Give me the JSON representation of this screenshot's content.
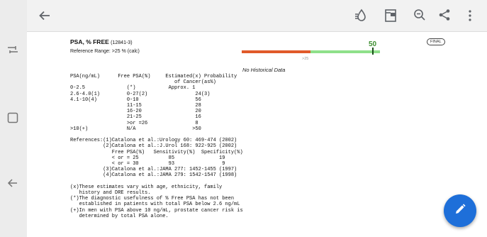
{
  "toolbar": {
    "icons": [
      "back-arrow-icon",
      "accessibility-icon",
      "document-icon",
      "zoom-out-icon",
      "share-icon",
      "more-vert-icon"
    ]
  },
  "system_nav": {
    "icons": [
      "recents-icon",
      "home-icon",
      "back-icon"
    ]
  },
  "test": {
    "title": "PSA, % FREE",
    "code": "(12841-3)",
    "reference_range": "Reference Range: >25 % (calc)",
    "status_badge": "FINAL",
    "value": "50",
    "value_fraction_on_bar": 0.94,
    "bar_threshold_label": ">25",
    "bar_colors": {
      "out_of_range": "#e05a2a",
      "in_range": "#8fe08a",
      "value_text": "#3f8f32"
    }
  },
  "report": {
    "history_note": "No Historical Data",
    "lines": [
      "PSA(ng/mL)      Free PSA(%)     Estimated(x) Probability",
      "                                   of Cancer(as%)",
      "0-2.5              (*)           Approx. 1",
      "2.6-4.0(1)         0-27(2)                24(3)",
      "4.1-10(4)          0-10                   56",
      "                   11-15                  28",
      "                   16-20                  20",
      "                   21-25                  16",
      "                   >or =26                8",
      ">10(+)             N/A                   >50",
      "",
      "References:(1)Catalona et al.:Urology 60: 469-474 (2002)",
      "           (2)Catalona et al.:J.Urol 168: 922-925 (2002)",
      "              Free PSA(%)   Sensitivity(%)  Specificity(%)",
      "              < or = 25          85               19",
      "              < or = 30          93                9",
      "           (3)Catalona et al.:JAMA 277: 1452-1455 (1997)",
      "           (4)Catalona et al.:JAMA 279: 1542-1547 (1998)",
      "",
      "(x)These estimates vary with age, ethnicity, family",
      "   history and DRE results.",
      "(*)The diagnostic usefulness of % Free PSA has not been",
      "   established in patients with total PSA below 2.6 ng/mL",
      "(+)In men with PSA above 10 ng/mL, prostate cancer risk is",
      "   determined by total PSA alone."
    ]
  },
  "fab": {
    "icon": "edit-pencil-icon"
  }
}
